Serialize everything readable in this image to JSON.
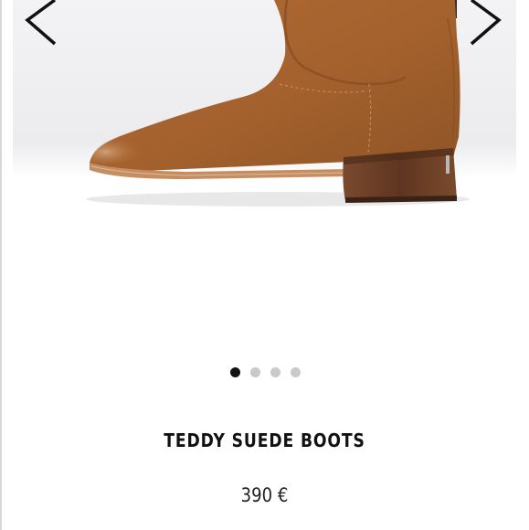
{
  "product": {
    "name": "TEDDY SUEDE BOOTS",
    "price": "390 €",
    "image_alt_icon": "boot-product-photo"
  },
  "carousel": {
    "prev_icon": "chevron-left-icon",
    "next_icon": "chevron-right-icon",
    "slides": [
      {
        "active": true
      },
      {
        "active": false
      },
      {
        "active": false
      },
      {
        "active": false
      }
    ]
  },
  "colors": {
    "suede": "#a8652f",
    "heel": "#6b3f26",
    "sole": "#c58e62",
    "active_dot": "#111111",
    "inactive_dot": "#c9c9c9"
  }
}
